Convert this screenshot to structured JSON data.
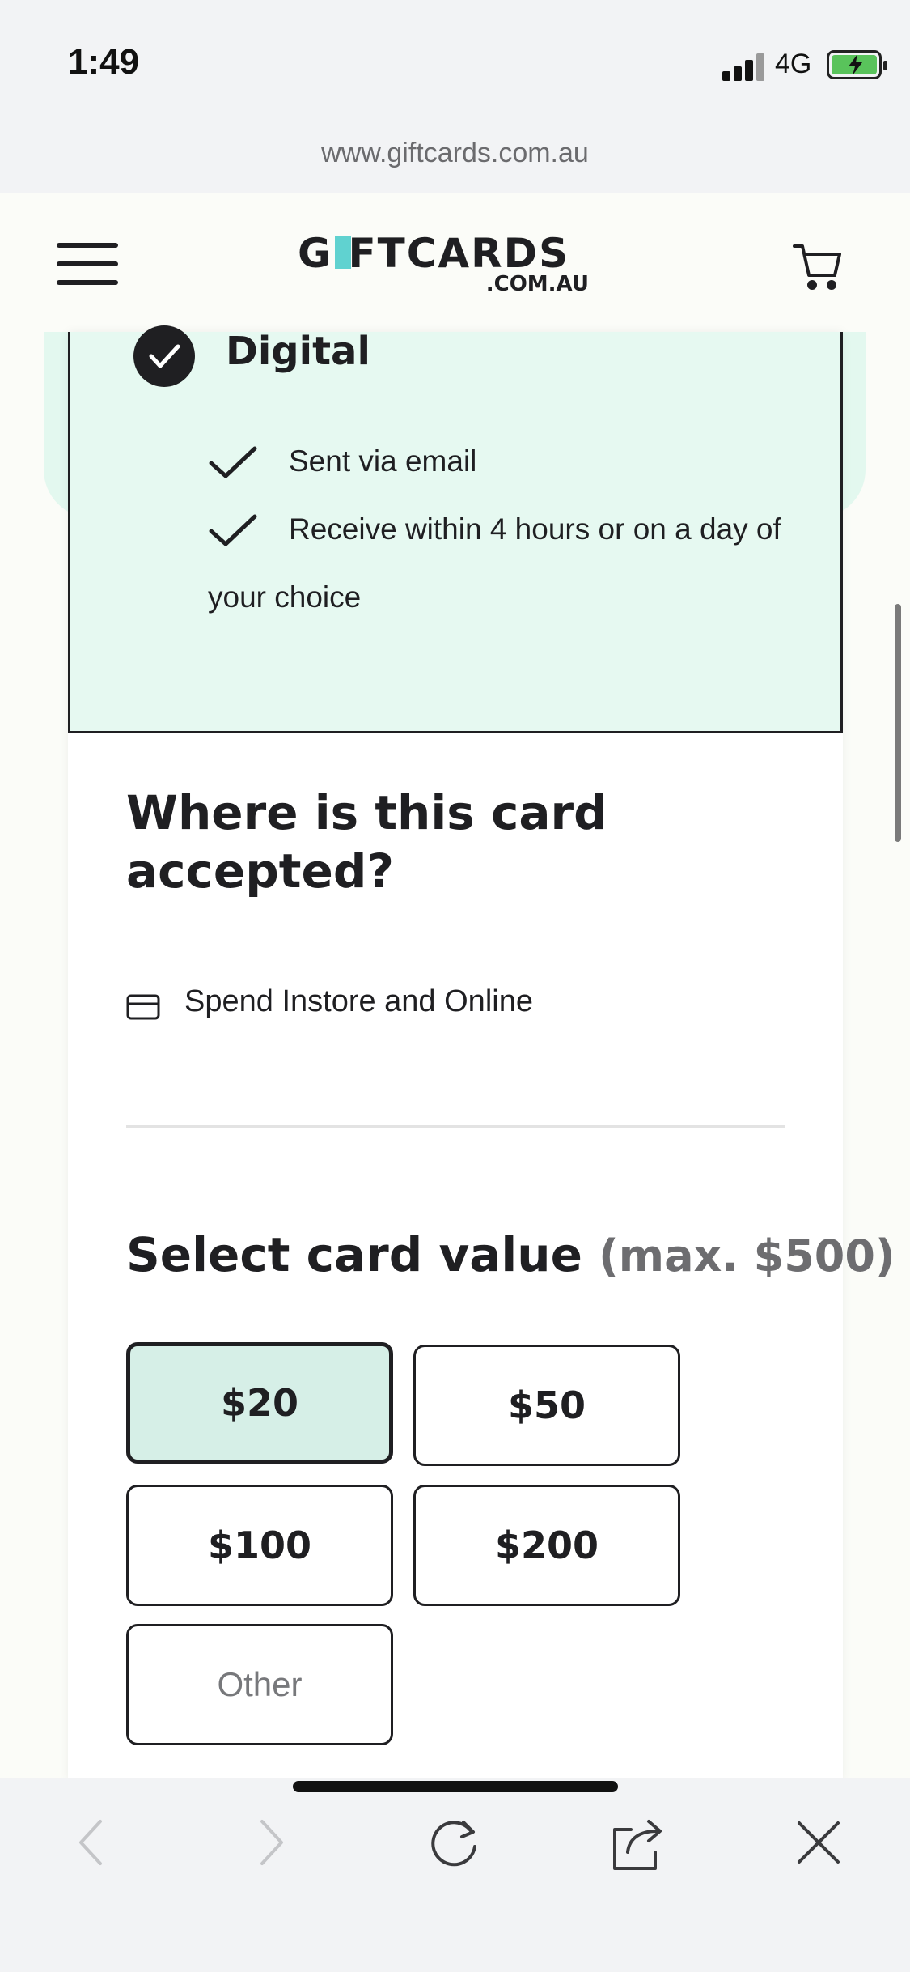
{
  "status_bar": {
    "time": "1:49",
    "network": "4G"
  },
  "browser": {
    "url": "www.giftcards.com.au"
  },
  "site_header": {
    "logo_main": "G FTCARDS",
    "logo_sub": ".COM.AU"
  },
  "digital_option": {
    "title": "Digital",
    "features": [
      "Sent via email",
      "Receive within 4 hours or on a day of your choice"
    ]
  },
  "acceptance": {
    "heading": "Where is this card accepted?",
    "item": "Spend Instore and Online"
  },
  "card_value": {
    "heading": "Select card value",
    "max_note": "(max. $500)",
    "options": [
      "$20",
      "$50",
      "$100",
      "$200",
      "Other"
    ],
    "selected": "$20"
  },
  "colors": {
    "accent": "#60d2d0",
    "selected_bg": "#d6efe7",
    "panel_bg": "#e6f9f1"
  },
  "icons": [
    "hamburger-menu-icon",
    "cart-icon",
    "check-circle-icon",
    "checkmark-icon",
    "card-icon",
    "back-icon",
    "forward-icon",
    "reload-icon",
    "share-icon",
    "close-icon"
  ]
}
